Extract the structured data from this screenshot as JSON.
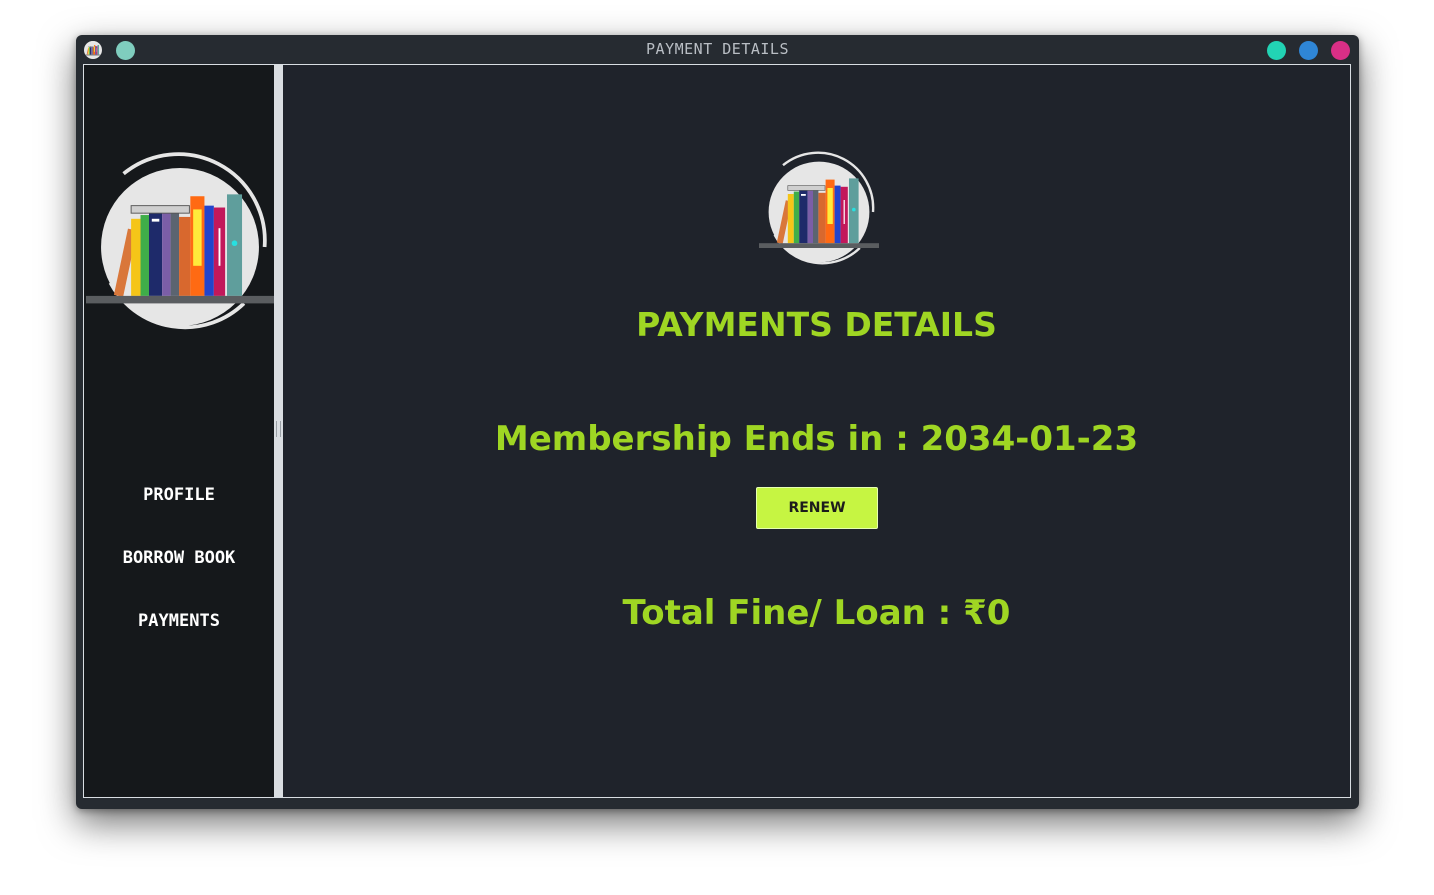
{
  "window": {
    "title": "PAYMENT DETAILS",
    "colors": {
      "dot_left": "#7fcdbe",
      "dot_green": "#22d3b4",
      "dot_blue": "#2f86d6",
      "dot_pink": "#d92f86"
    }
  },
  "sidebar": {
    "logo_icon": "bookshelf-logo-icon",
    "items": [
      {
        "label": "PROFILE"
      },
      {
        "label": "BORROW BOOK"
      },
      {
        "label": "PAYMENTS"
      }
    ]
  },
  "main": {
    "logo_icon": "bookshelf-logo-icon",
    "title": "PAYMENTS DETAILS",
    "membership_text": "Membership Ends in : 2034-01-23",
    "renew_label": "RENEW",
    "fine_text": "Total Fine/ Loan : ₹0",
    "accent_color": "#9fd623",
    "button_color": "#c6f542"
  }
}
